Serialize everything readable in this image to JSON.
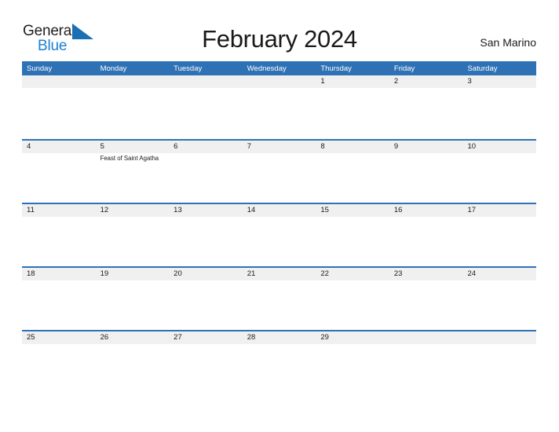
{
  "brand": {
    "name_part1": "General",
    "name_part2": "Blue",
    "flag_icon": "blue-flag-icon",
    "color_dark": "#231f20",
    "color_blue": "#1b7fd4"
  },
  "header": {
    "title": "February 2024",
    "region": "San Marino"
  },
  "calendar": {
    "accent_color": "#2e72b5",
    "band_color": "#f0f0f0",
    "weekday_headers": [
      "Sunday",
      "Monday",
      "Tuesday",
      "Wednesday",
      "Thursday",
      "Friday",
      "Saturday"
    ],
    "weeks": [
      {
        "days": [
          {
            "num": "",
            "events": []
          },
          {
            "num": "",
            "events": []
          },
          {
            "num": "",
            "events": []
          },
          {
            "num": "",
            "events": []
          },
          {
            "num": "1",
            "events": []
          },
          {
            "num": "2",
            "events": []
          },
          {
            "num": "3",
            "events": []
          }
        ]
      },
      {
        "days": [
          {
            "num": "4",
            "events": []
          },
          {
            "num": "5",
            "events": [
              "Feast of Saint Agatha"
            ]
          },
          {
            "num": "6",
            "events": []
          },
          {
            "num": "7",
            "events": []
          },
          {
            "num": "8",
            "events": []
          },
          {
            "num": "9",
            "events": []
          },
          {
            "num": "10",
            "events": []
          }
        ]
      },
      {
        "days": [
          {
            "num": "11",
            "events": []
          },
          {
            "num": "12",
            "events": []
          },
          {
            "num": "13",
            "events": []
          },
          {
            "num": "14",
            "events": []
          },
          {
            "num": "15",
            "events": []
          },
          {
            "num": "16",
            "events": []
          },
          {
            "num": "17",
            "events": []
          }
        ]
      },
      {
        "days": [
          {
            "num": "18",
            "events": []
          },
          {
            "num": "19",
            "events": []
          },
          {
            "num": "20",
            "events": []
          },
          {
            "num": "21",
            "events": []
          },
          {
            "num": "22",
            "events": []
          },
          {
            "num": "23",
            "events": []
          },
          {
            "num": "24",
            "events": []
          }
        ]
      },
      {
        "days": [
          {
            "num": "25",
            "events": []
          },
          {
            "num": "26",
            "events": []
          },
          {
            "num": "27",
            "events": []
          },
          {
            "num": "28",
            "events": []
          },
          {
            "num": "29",
            "events": []
          },
          {
            "num": "",
            "events": []
          },
          {
            "num": "",
            "events": []
          }
        ]
      }
    ]
  }
}
